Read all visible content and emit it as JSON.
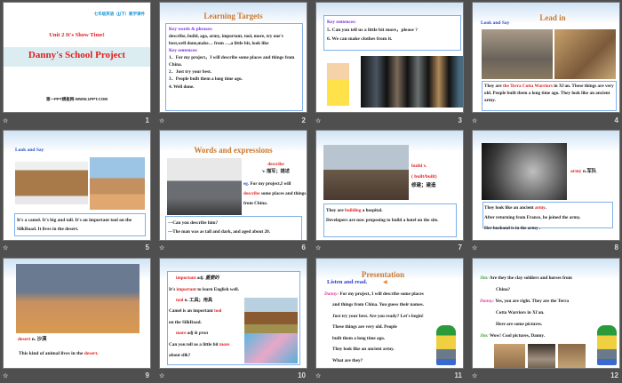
{
  "slides": [
    {
      "number": "1",
      "header": "七年级英语（JJ下）教学课件",
      "unit": "Unit 2   It's Show Time!",
      "title": "Danny's School Project",
      "site": "第一PPT模板网-WWW.1PPT.COM"
    },
    {
      "number": "2",
      "title": "Learning Targets",
      "kw_label": "Key words & phrases:",
      "kw": "describe, build, ago, army, important, tool, more, try one's best,well done,make… from …,a little bit, look like",
      "ks_label": "Key sentences:",
      "sentences": [
        "1．For my project，I will describe some places and things from China.",
        "2．Just try your best.",
        "3．People built them a long time ago.",
        "4.  Well done."
      ]
    },
    {
      "number": "3",
      "ks_label": "Key sentences:",
      "sentences": [
        "5. Can you tell us a little bit more，please ?",
        "6. We can make clothes from it."
      ]
    },
    {
      "number": "4",
      "title": "Lead in",
      "look": "Look  and  Say",
      "t1": " They are ",
      "hl": "the Terra Cotta Warriors",
      "t2": " in Xi'an. These things are very old. People built them a long time ago. They look like an ancient army."
    },
    {
      "number": "5",
      "look": "Look  and  Say",
      "text": " It's a camel. It's big and tall. It's an important tool on the SilkRoad. It lives in the desert."
    },
    {
      "number": "6",
      "title": "Words and expressions",
      "word": "describe",
      "pos": "v. 描写；描述",
      "eg": "eg.",
      "t1": " For my project,I will ",
      "hl": "describe",
      "t2": " some places and things from China.",
      "q": "—Can you describe him?",
      "a": "—The man was as tall and dark, and aged about 20."
    },
    {
      "number": "7",
      "word": "build  v.",
      "forms": "( built/built)",
      "cn": "修建；建造",
      "t1": "They are ",
      "hl": "building",
      "t2": " a hospital.",
      "s2": "Developers are now proposing to build a hotel on the site."
    },
    {
      "number": "8",
      "word": "army",
      "pos": " n.军队",
      "t1": "They look like an ancient ",
      "hl": "army",
      "t2": ".",
      "s2": "After returning from France, he joined the army.",
      "s3": "Her husband is in the army ."
    },
    {
      "number": "9",
      "word": "desert",
      "pos": "  n. 沙漠",
      "t1": "This kind of animal lives in the ",
      "hl": "desert",
      "t2": "."
    },
    {
      "number": "10",
      "w1": "important",
      "p1": " adj. 重要的",
      "s1a": "It's ",
      "s1b": " to learn English well.",
      "w2": "tool",
      "p2": "  n. 工具；用具",
      "s2a": "Camel is an important ",
      "s2c": "on the SilkRoad.",
      "w3": "more",
      "p3": "  adj & pron",
      "s3a": "Can you tell us a little bit ",
      "s3c": "about silk?"
    },
    {
      "number": "11",
      "title": "Presentation",
      "listen": "Listen and read.",
      "speaker": "Danny:",
      "lines": [
        " For my project, I will describe some places",
        "and things from China. You guess their names.",
        "Just try your best. Are you ready? Let's begin!",
        "These things are very old. People",
        " built them a long time ago.",
        "They look like an ancient army.",
        " What are they?"
      ]
    },
    {
      "number": "12",
      "jim": "Jim:",
      "danny": "Danny:",
      "l1": " Are they the clay soldiers and horses from",
      "l1b": "China?",
      "l2": " Yes, you are right. They are the Terra",
      "l2b": "Cotta Warriors in Xi'an.",
      "l2c": "Here are some pictures.",
      "l3": " Wow! Cool pictures, Danny."
    }
  ]
}
